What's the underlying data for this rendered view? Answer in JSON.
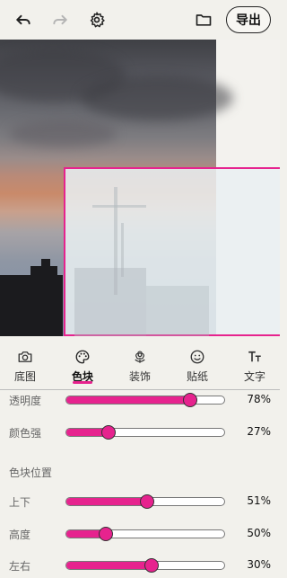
{
  "toolbar": {
    "undo_icon": "undo-icon",
    "redo_icon": "redo-icon",
    "settings_icon": "gear-icon",
    "folder_icon": "folder-icon",
    "export_label": "导出"
  },
  "tabs": [
    {
      "label": "底图",
      "icon": "camera-icon"
    },
    {
      "label": "色块",
      "icon": "palette-icon",
      "active": true
    },
    {
      "label": "装饰",
      "icon": "flower-icon"
    },
    {
      "label": "贴纸",
      "icon": "smiley-icon"
    },
    {
      "label": "文字",
      "icon": "text-icon"
    }
  ],
  "sliders": {
    "opacity": {
      "label": "透明度",
      "value": 78,
      "value_text": "78%"
    },
    "color_strength": {
      "label": "颜色强",
      "value": 27,
      "value_text": "27%"
    },
    "position_title": "色块位置",
    "vertical": {
      "label": "上下",
      "value": 51,
      "value_text": "51%"
    },
    "height": {
      "label": "高度",
      "value": 50,
      "value_text": "50%"
    },
    "horizontal": {
      "label": "左右",
      "value": 30,
      "value_text": "30%"
    }
  },
  "colors": {
    "accent": "#e6238e",
    "background": "#f2f1ec"
  }
}
